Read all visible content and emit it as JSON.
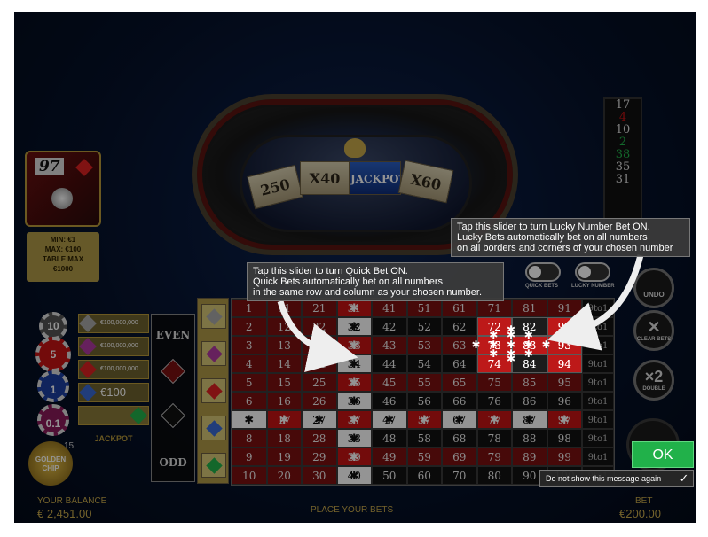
{
  "wheel": {
    "multipliers": [
      "250",
      "X40",
      "JACKPOT",
      "X60"
    ]
  },
  "last_number": "97",
  "limits": {
    "min": "MIN: €1",
    "max": "MAX: €100",
    "table_max_label": "TABLE MAX",
    "table_max_value": "€1000"
  },
  "chips": [
    "10",
    "5",
    "1",
    "0.1"
  ],
  "jackpots": {
    "rows": [
      "€100,000,000",
      "€100,000,000",
      "€100,000,000",
      "€100"
    ],
    "label": "JACKPOT"
  },
  "golden_chip": {
    "label": "GOLDEN CHIP",
    "count": "15"
  },
  "outside_bets": {
    "even": "EVEN",
    "odd": "ODD"
  },
  "grid": {
    "rows": [
      [
        "1",
        "11",
        "21",
        "31",
        "41",
        "51",
        "61",
        "71",
        "81",
        "91"
      ],
      [
        "2",
        "12",
        "22",
        "32",
        "42",
        "52",
        "62",
        "72",
        "82",
        "92"
      ],
      [
        "3",
        "13",
        "23",
        "33",
        "43",
        "53",
        "63",
        "73",
        "83",
        "93"
      ],
      [
        "4",
        "14",
        "24",
        "34",
        "44",
        "54",
        "64",
        "74",
        "84",
        "94"
      ],
      [
        "5",
        "15",
        "25",
        "35",
        "45",
        "55",
        "65",
        "75",
        "85",
        "95"
      ],
      [
        "6",
        "16",
        "26",
        "36",
        "46",
        "56",
        "66",
        "76",
        "86",
        "96"
      ],
      [
        "7",
        "17",
        "27",
        "37",
        "47",
        "57",
        "67",
        "77",
        "87",
        "97"
      ],
      [
        "8",
        "18",
        "28",
        "38",
        "48",
        "58",
        "68",
        "78",
        "88",
        "98"
      ],
      [
        "9",
        "19",
        "29",
        "39",
        "49",
        "59",
        "69",
        "79",
        "89",
        "99"
      ],
      [
        "10",
        "20",
        "30",
        "40",
        "50",
        "60",
        "70",
        "80",
        "90",
        "100"
      ]
    ],
    "column_label": "9to1",
    "red_cells": [
      "1",
      "3",
      "5",
      "7",
      "9",
      "11",
      "13",
      "15",
      "17",
      "19",
      "21",
      "23",
      "25",
      "27",
      "29",
      "31",
      "33",
      "35",
      "37",
      "39",
      "41",
      "43",
      "45",
      "47",
      "49",
      "51",
      "53",
      "55",
      "57",
      "59",
      "61",
      "63",
      "65",
      "67",
      "69",
      "71",
      "73",
      "75",
      "77",
      "79",
      "81",
      "83",
      "85",
      "87",
      "89",
      "91",
      "93",
      "95",
      "97",
      "99",
      "72",
      "92",
      "74",
      "94",
      "2",
      "4",
      "6",
      "8",
      "10",
      "12",
      "14",
      "16",
      "18",
      "20",
      "22",
      "24",
      "26",
      "28",
      "30",
      "32",
      "34",
      "36",
      "38",
      "40"
    ],
    "quick_bet_column_index": 3,
    "quick_bet_row_index": 6,
    "lucky_cells": [
      [
        1,
        7
      ],
      [
        1,
        8
      ],
      [
        1,
        9
      ],
      [
        2,
        7
      ],
      [
        2,
        8
      ],
      [
        2,
        9
      ],
      [
        3,
        7
      ],
      [
        3,
        8
      ],
      [
        3,
        9
      ]
    ]
  },
  "history": [
    {
      "n": "17",
      "color": "#dddddd"
    },
    {
      "n": "4",
      "color": "#c71414"
    },
    {
      "n": "10",
      "color": "#dddddd"
    },
    {
      "n": "2",
      "color": "#21b14a"
    },
    {
      "n": "38",
      "color": "#21b14a"
    },
    {
      "n": "35",
      "color": "#dddddd"
    },
    {
      "n": "31",
      "color": "#dddddd"
    }
  ],
  "right_buttons": {
    "undo": "UNDO",
    "clear_icon": "✕",
    "clear": "CLEAR BETS",
    "double_icon": "×2",
    "double": "DOUBLE"
  },
  "toggles": {
    "quick_bets": "QUICK BETS",
    "lucky_number": "LUCKY NUMBER"
  },
  "tooltips": {
    "lucky": [
      "Tap this slider to turn Lucky Number Bet ON.",
      "Lucky Bets automatically bet on all numbers",
      "on all borders and corners of your chosen number"
    ],
    "quick": [
      "Tap this slider to turn Quick Bet ON.",
      "Quick Bets automatically bet on all numbers",
      "in the same row and column as your chosen number."
    ]
  },
  "bottom": {
    "balance_label": "YOUR BALANCE",
    "balance_value": "€ 2,451.00",
    "center_message": "PLACE YOUR BETS",
    "bet_label": "BET",
    "bet_value": "€200.00"
  },
  "dialog": {
    "ok": "OK",
    "dont_show": "Do not show this message again",
    "checkmark": "✓"
  },
  "colors": {
    "red": "#7a1010",
    "black": "#121212",
    "gold": "#b09948",
    "ok_green": "#21b14a"
  }
}
